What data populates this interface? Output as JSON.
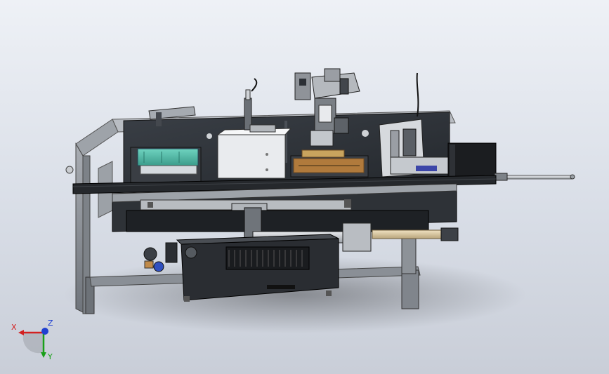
{
  "triad": {
    "x_label": "X",
    "y_label": "Y",
    "z_label": "Z"
  },
  "colors": {
    "background_top": "#eef1f6",
    "background_bottom": "#c9ced8",
    "frame": "#8e939a",
    "panel_dark": "#2c3036",
    "rail": "#1f2226",
    "teal_module": "#4fb8a6",
    "copper_module": "#b07a3c",
    "cylinder": "#d9c6a0",
    "axis_x": "#d32020",
    "axis_y": "#19a019",
    "axis_z": "#2040d0"
  }
}
